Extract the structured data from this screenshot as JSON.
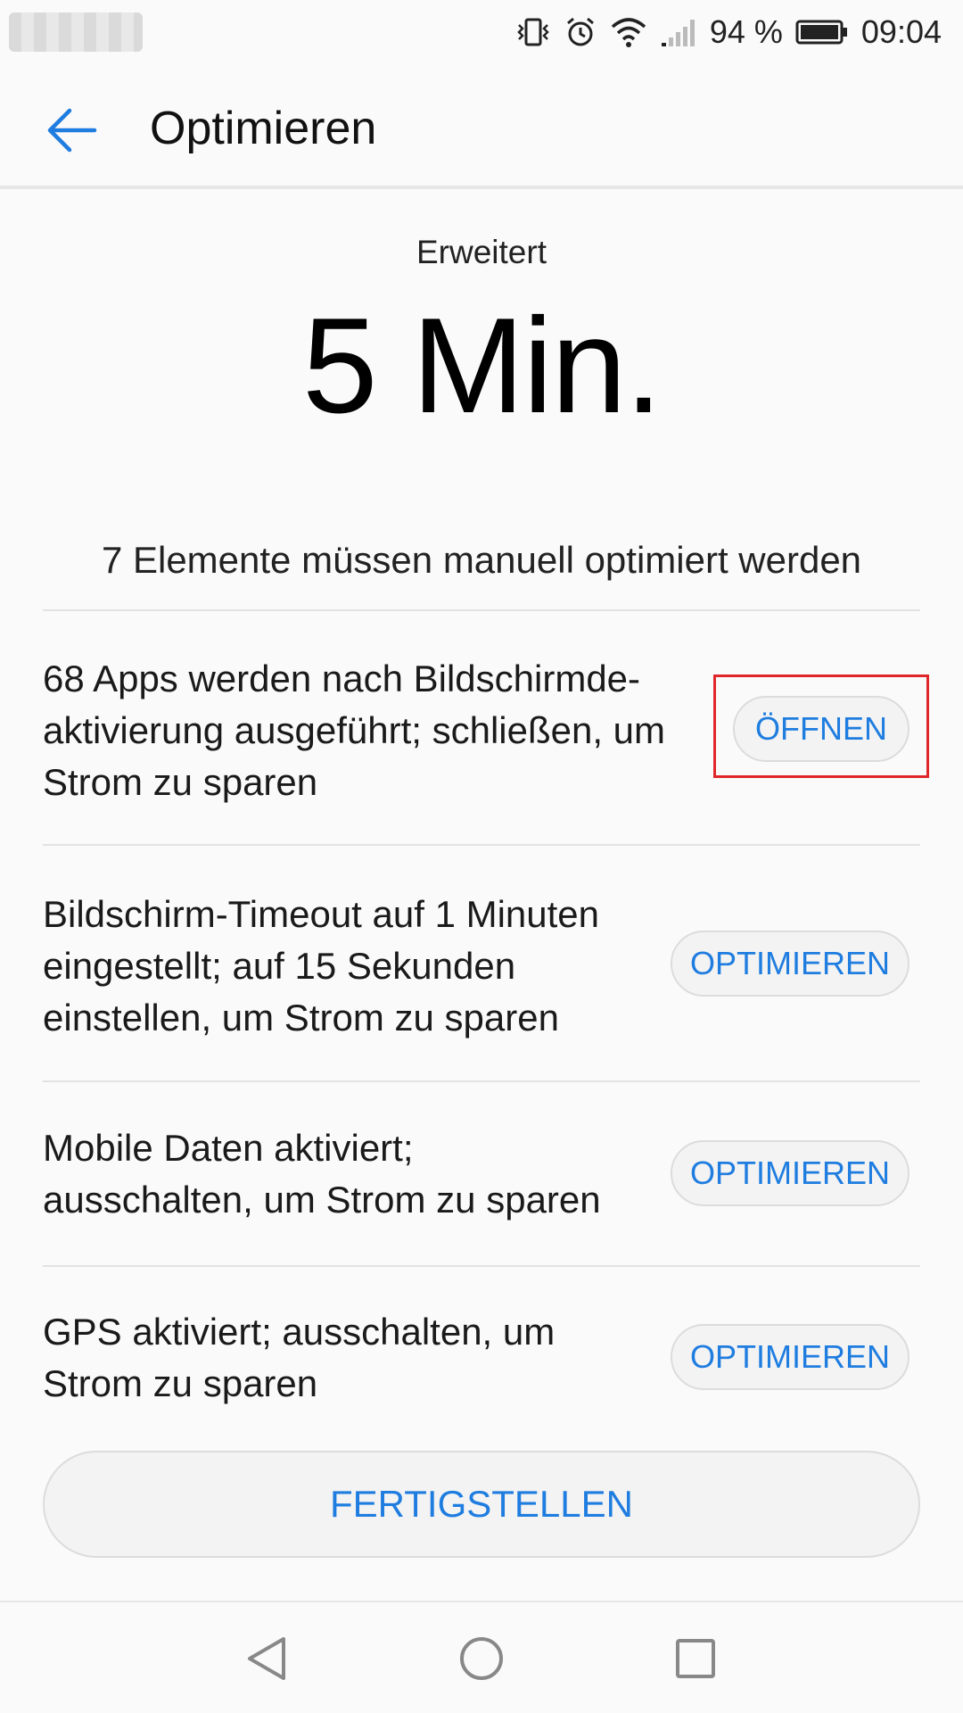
{
  "statusbar": {
    "battery_percent": "94 %",
    "time": "09:04",
    "icons": [
      "vibrate-icon",
      "alarm-icon",
      "wifi-icon",
      "signal-icon",
      "battery-icon"
    ]
  },
  "appbar": {
    "title": "Optimieren",
    "back_icon": "arrow-back-icon"
  },
  "header": {
    "mode_label": "Erweitert",
    "time_value": "5 Min."
  },
  "summary": "7 Elemente müssen manuell optimiert werden",
  "items": [
    {
      "line1": "68 Apps werden nach Bildschirmde-",
      "line2": "aktivierung ausgeführt; schließen, um",
      "line3": "Strom zu sparen",
      "action": "ÖFFNEN"
    },
    {
      "line1": "Bildschirm-Timeout auf 1 Minuten",
      "line2": "eingestellt; auf 15 Sekunden",
      "line3": "einstellen, um Strom zu sparen",
      "action": "OPTIMIEREN"
    },
    {
      "line1": "Mobile Daten aktiviert;",
      "line2": "ausschalten, um Strom zu sparen",
      "action": "OPTIMIEREN"
    },
    {
      "line1": "GPS aktiviert; ausschalten, um",
      "line2": "Strom zu sparen",
      "action": "OPTIMIEREN"
    }
  ],
  "finish_button": "FERTIGSTELLEN",
  "navbar": {
    "icons": [
      "nav-back-icon",
      "nav-home-icon",
      "nav-recents-icon"
    ]
  },
  "colors": {
    "accent": "#1f7de0",
    "highlight": "#e0262a",
    "background": "#fafafa"
  }
}
